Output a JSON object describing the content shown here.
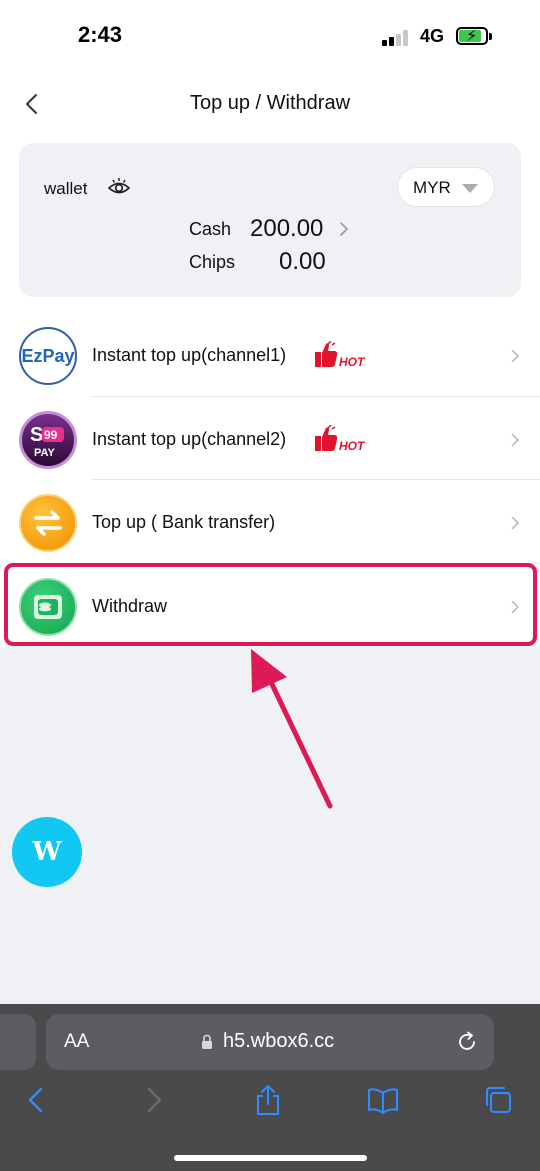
{
  "status_bar": {
    "time": "2:43",
    "network": "4G",
    "battery_color": "#3cc84a"
  },
  "header": {
    "title": "Top up / Withdraw",
    "back_icon": "chevron-left-icon"
  },
  "wallet": {
    "label": "wallet",
    "eye_icon": "eye-icon",
    "currency": "MYR",
    "cash_label": "Cash",
    "cash_value": "200.00",
    "chips_label": "Chips",
    "chips_value": "0.00"
  },
  "menu": {
    "items": [
      {
        "label": "Instant top up(channel1)",
        "logo_text": "EzPay",
        "hot": true,
        "hot_text": "HOT"
      },
      {
        "label": "Instant top up(channel2)",
        "logo_text": "99 PAY",
        "hot": true,
        "hot_text": "HOT"
      },
      {
        "label": "Top up ( Bank transfer)",
        "logo": "transfer-arrows-icon",
        "hot": false
      },
      {
        "label": "Withdraw",
        "logo": "wallet-cash-icon",
        "hot": false
      }
    ]
  },
  "highlight": {
    "color": "#dc1a55",
    "target": "Withdraw"
  },
  "fab": {
    "letter": "W",
    "color": "#12c8f2"
  },
  "browser": {
    "aa_label": "AA",
    "url": "h5.wbox6.cc",
    "toolbar": [
      "back-icon",
      "forward-icon",
      "share-icon",
      "bookmarks-icon",
      "tabs-icon"
    ]
  }
}
